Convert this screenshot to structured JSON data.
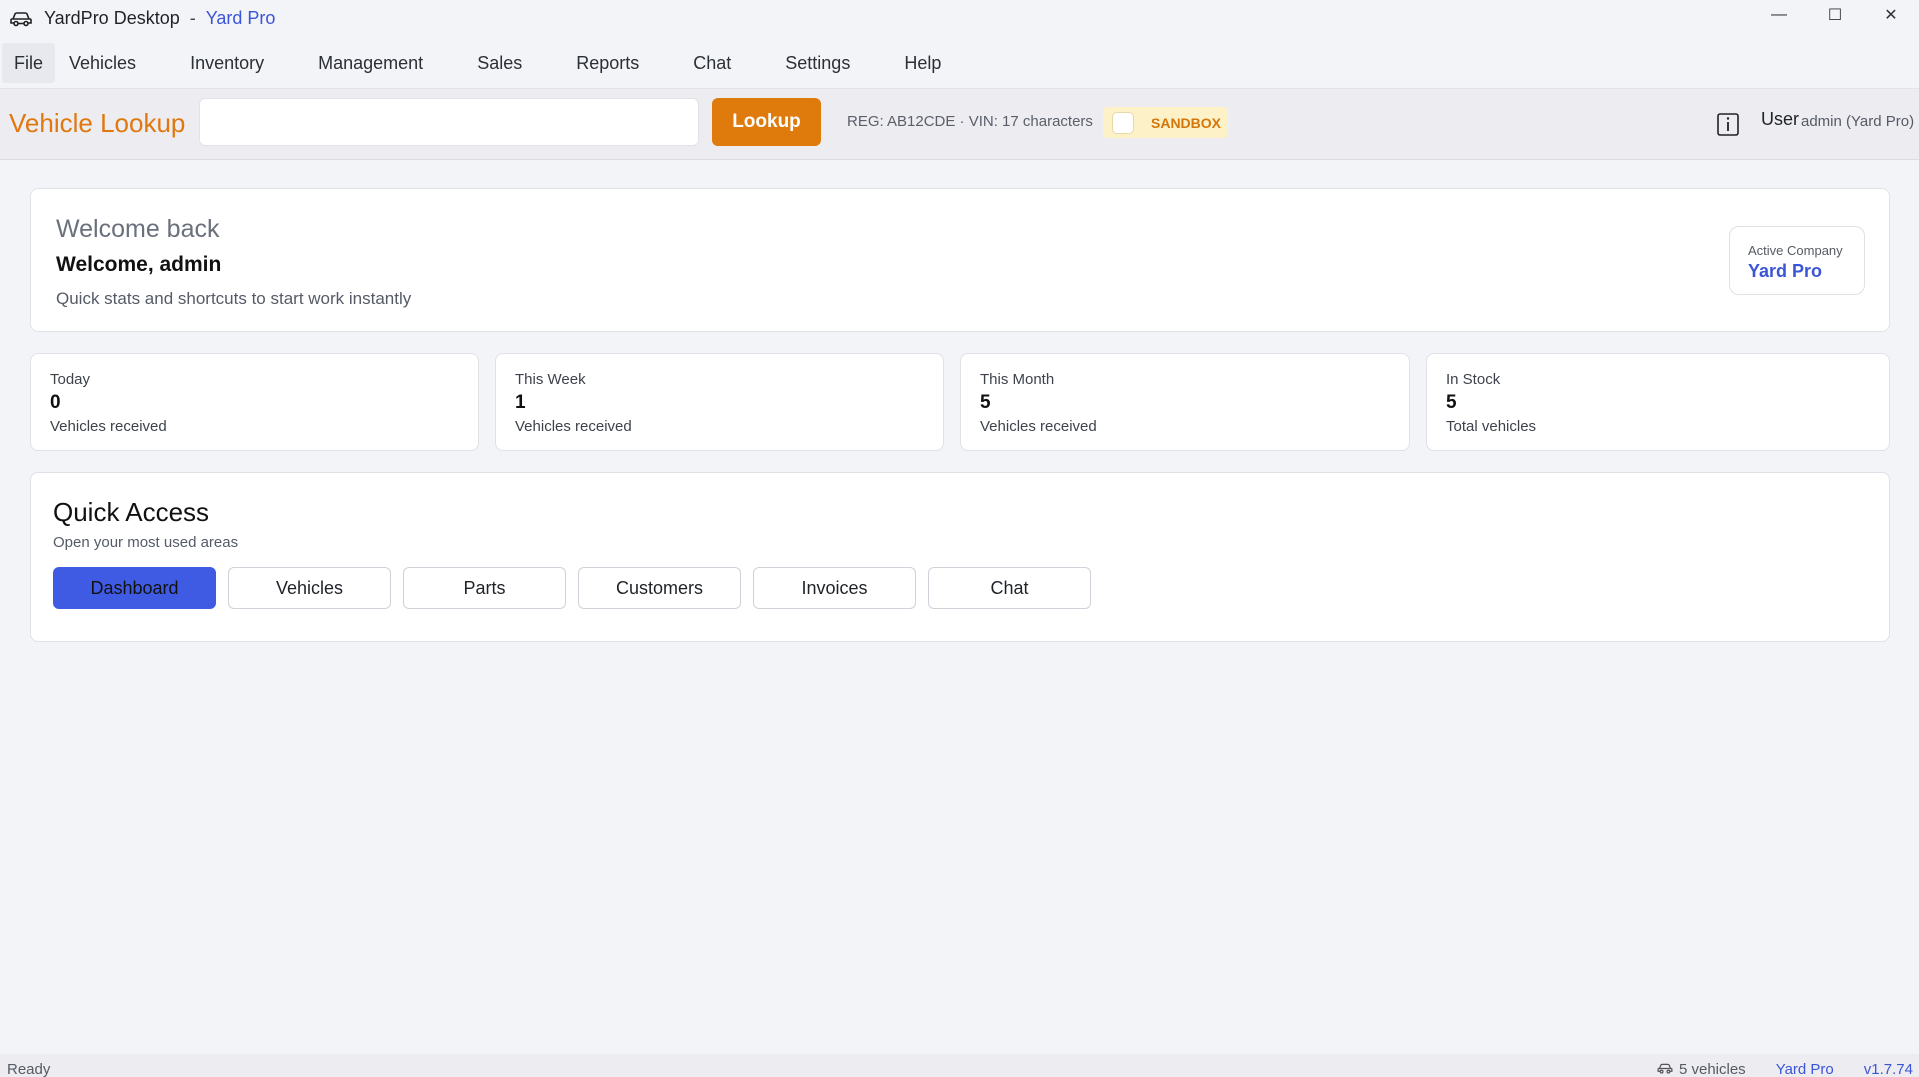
{
  "titlebar": {
    "app_name": "YardPro Desktop",
    "separator": "-",
    "company": "Yard Pro",
    "icon": "car-icon",
    "controls": {
      "minimize": "—",
      "maximize": "☐",
      "close": "✕"
    }
  },
  "menu": [
    "File",
    "Vehicles",
    "Inventory",
    "Management",
    "Sales",
    "Reports",
    "Chat",
    "Settings",
    "Help"
  ],
  "lookup": {
    "title": "Vehicle Lookup",
    "input_value": "",
    "button": "Lookup",
    "hint": "REG: AB12CDE  ·  VIN: 17 characters",
    "sandbox_label": "SANDBOX",
    "sandbox_checked": false,
    "user_label": "User",
    "user_value": "admin (Yard Pro)"
  },
  "welcome": {
    "eyebrow": "Welcome back",
    "title": "Welcome, admin",
    "subtitle": "Quick stats and shortcuts to start work instantly",
    "company_label": "Active Company",
    "company_name": "Yard Pro"
  },
  "stats": [
    {
      "label": "Today",
      "value": "0",
      "sub": "Vehicles received"
    },
    {
      "label": "This Week",
      "value": "1",
      "sub": "Vehicles received"
    },
    {
      "label": "This Month",
      "value": "5",
      "sub": "Vehicles received"
    },
    {
      "label": "In Stock",
      "value": "5",
      "sub": "Total vehicles"
    }
  ],
  "quick_access": {
    "title": "Quick Access",
    "subtitle": "Open your most used areas",
    "buttons": [
      "Dashboard",
      "Vehicles",
      "Parts",
      "Customers",
      "Invoices",
      "Chat"
    ]
  },
  "status": {
    "left": "Ready",
    "vehicles": "5 vehicles",
    "company": "Yard Pro",
    "version": "v1.7.74"
  },
  "colors": {
    "accent_orange": "#df7a0c",
    "accent_blue": "#3b55d8",
    "primary_button": "#3f5be4",
    "sandbox_bg": "#fdf1c8"
  }
}
